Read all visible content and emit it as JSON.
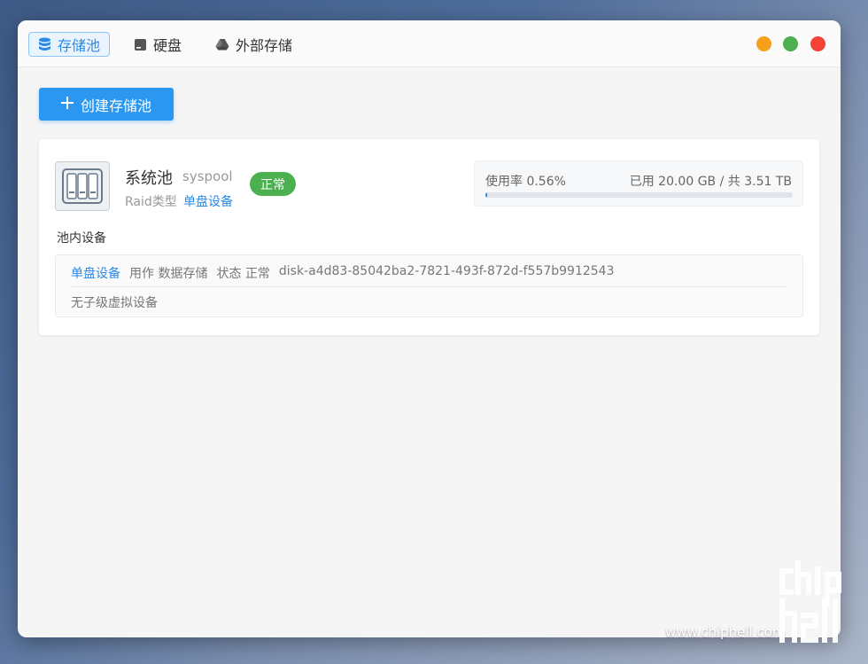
{
  "tabs": [
    {
      "label": "存储池",
      "icon": "database-icon",
      "active": true
    },
    {
      "label": "硬盘",
      "icon": "hard-drive-icon",
      "active": false
    },
    {
      "label": "外部存储",
      "icon": "cloud-drive-icon",
      "active": false
    }
  ],
  "window_controls": {
    "minimize_color": "#f5a01a",
    "maximize_color": "#4caf50",
    "close_color": "#f44336"
  },
  "create_button": {
    "icon": "plus-icon",
    "label": "创建存储池"
  },
  "pool": {
    "name": "系统池",
    "id": "syspool",
    "raid_label": "Raid类型",
    "raid_value": "单盘设备",
    "status": "正常",
    "usage_rate_text": "使用率 0.56%",
    "usage_fraction": 0.0056,
    "usage_total_text": "已用 20.00 GB / 共 3.51 TB"
  },
  "devices_section": {
    "title": "池内设备",
    "device": {
      "type": "单盘设备",
      "role": "用作 数据存储",
      "status": "状态 正常",
      "disk_id": "disk-a4d83-85042ba2-7821-493f-872d-f557b9912543"
    },
    "sub_devices": "无子级虚拟设备"
  },
  "watermark": {
    "site": "www.chiphell.com",
    "logo_text": "chip hell"
  },
  "colors": {
    "accent": "#2a8ae6",
    "success": "#4caf50"
  }
}
